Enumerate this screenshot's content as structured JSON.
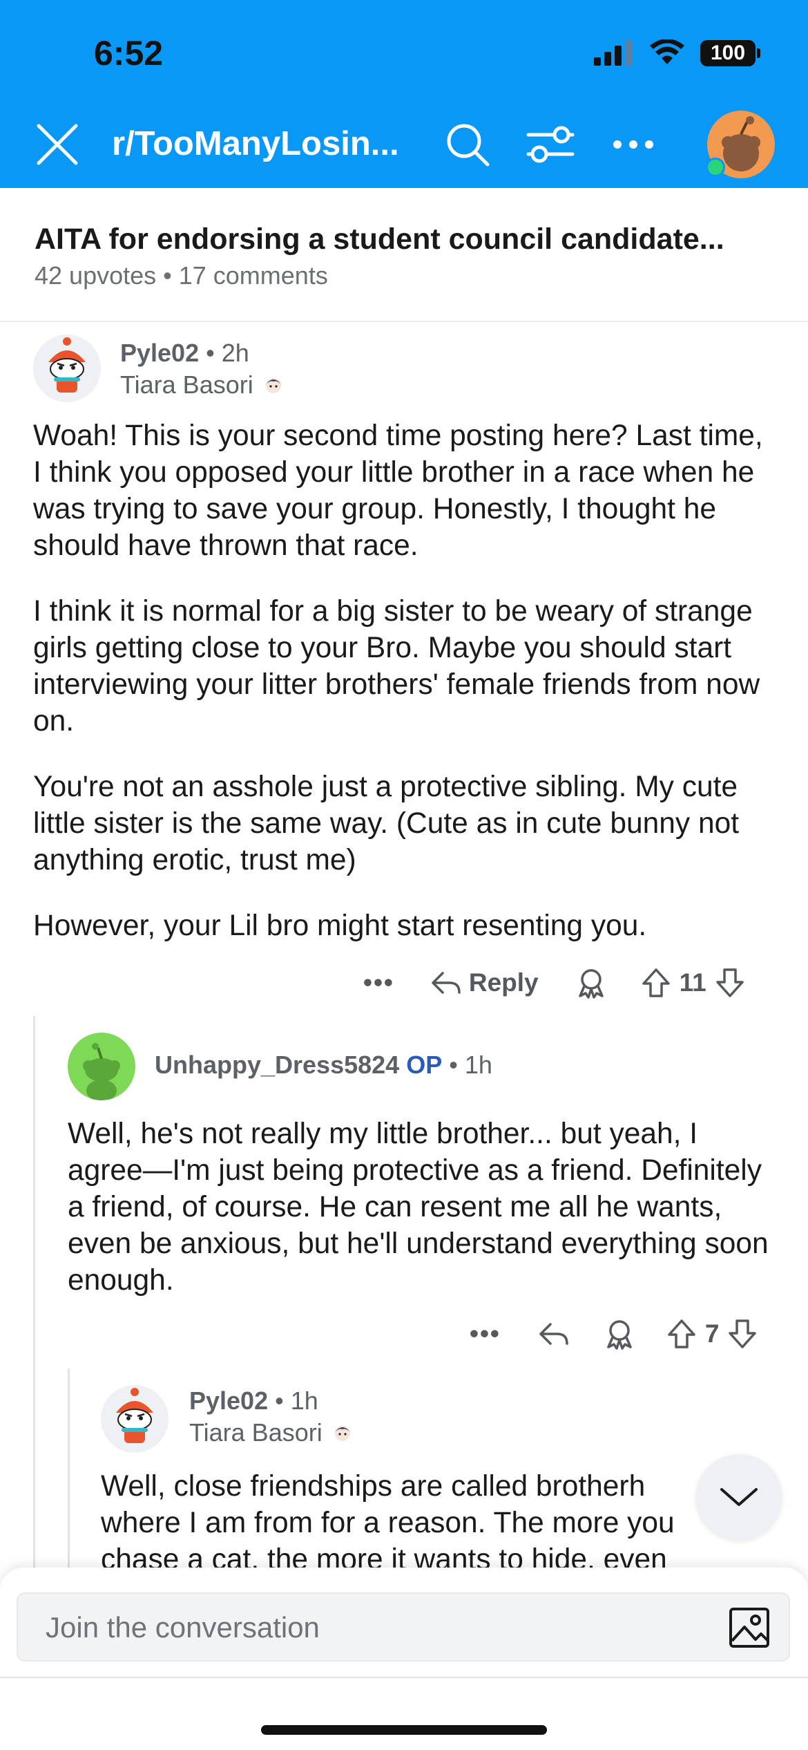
{
  "status_bar": {
    "time": "6:52",
    "battery": "100"
  },
  "nav": {
    "subreddit": "r/TooManyLosin...",
    "colors": {
      "bar": "#0a98f7",
      "accent_op": "#2a5bb8"
    }
  },
  "post": {
    "title": "AITA for endorsing a student council candidate...",
    "meta": "42 upvotes • 17 comments"
  },
  "comments": [
    {
      "username": "Pyle02",
      "time": "• 2h",
      "flair": "Tiara Basori",
      "paragraphs": [
        "Woah! This is your second time posting here? Last time, I think you opposed your little brother in a race when he was trying to save your group. Honestly, I thought he should have thrown that race.",
        "I think it is normal for a big sister to be weary of strange girls getting close to your Bro. Maybe you should start interviewing your litter brothers' female friends from now on.",
        "You're not an asshole just a protective sibling. My cute little sister is the same way. (Cute as in cute bunny not anything erotic, trust me)",
        "However, your Lil bro might start resenting you."
      ],
      "more": "•••",
      "reply_label": "Reply",
      "votes": "11"
    },
    {
      "username": "Unhappy_Dress5824",
      "op": "OP",
      "time": "• 1h",
      "paragraphs": [
        "Well, he's not really my little brother... but yeah, I agree—I'm just being protective as a friend. Definitely a friend, of course. He can resent me all he wants, even be anxious, but he'll understand everything soon enough."
      ],
      "more": "•••",
      "votes": "7"
    },
    {
      "username": "Pyle02",
      "time": "• 1h",
      "flair": "Tiara Basori",
      "paragraphs": [
        "Well, close friendships are called brotherh where I am from for a reason. The more you chase a cat, the more it wants to hide, even"
      ]
    }
  ],
  "composer": {
    "placeholder": "Join the conversation"
  }
}
